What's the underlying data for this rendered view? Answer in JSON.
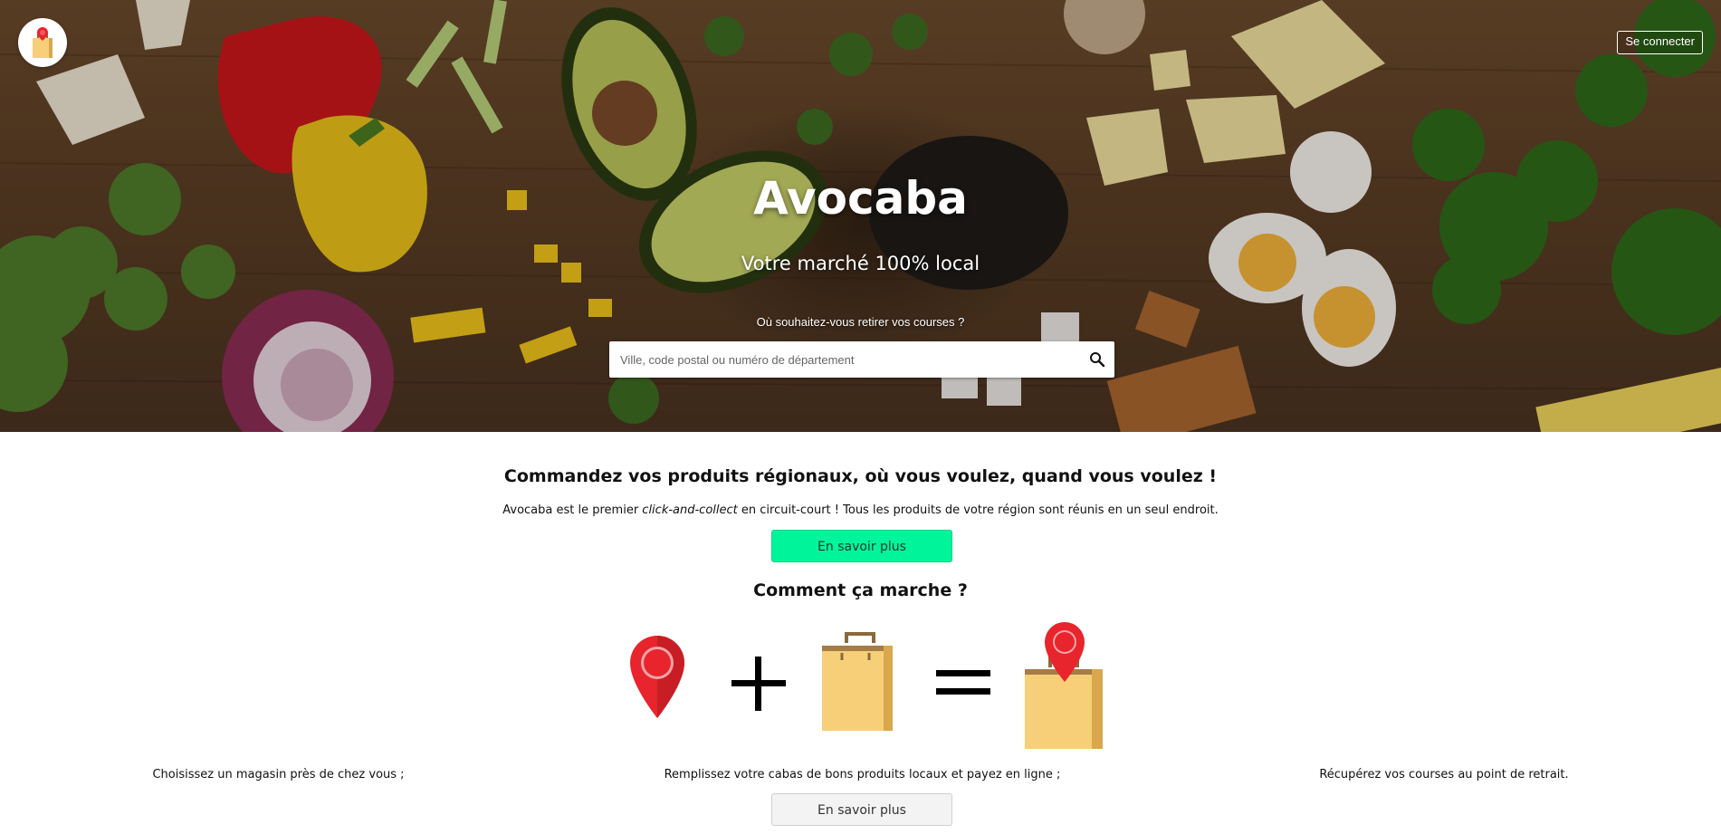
{
  "app": {
    "logo": "avocaba-logo",
    "name": "Avocaba"
  },
  "header": {
    "login_label": "Se connecter"
  },
  "hero": {
    "title": "Avocaba",
    "subtitle": "Votre marché 100% local",
    "question": "Où souhaitez-vous retirer vos courses ?",
    "search_placeholder": "Ville, code postal ou numéro de département",
    "search_value": "",
    "search_icon": "search-icon"
  },
  "intro": {
    "headline": "Commandez vos produits régionaux, où vous voulez, quand vous voulez !",
    "text_before": "Avocaba est le premier ",
    "text_emphasis": "click-and-collect",
    "text_after": " en circuit-court ! Tous les produits de votre région sont réunis en un seul endroit.",
    "button_label": "En savoir plus"
  },
  "how": {
    "title": "Comment ça marche ?",
    "icons": [
      "map-pin-icon",
      "plus-icon",
      "shopping-bag-icon",
      "equals-icon",
      "bag-with-pin-icon"
    ],
    "steps": [
      "Choisissez un magasin près de chez vous ;",
      "Remplissez votre cabas de bons produits locaux et payez en ligne ;",
      "Récupérez vos courses au point de retrait."
    ],
    "button_label": "En savoir plus"
  },
  "colors": {
    "accent_green": "#00f59a",
    "pin_red": "#e8242c",
    "bag_tan": "#f7cf78"
  }
}
